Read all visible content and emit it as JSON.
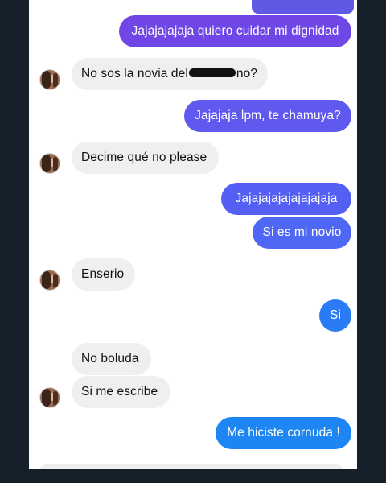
{
  "messages": {
    "m1": "Jajajajajaja quiero cuidar mi dignidad",
    "m2_start": "No sos la novia del",
    "m2_end": "no?",
    "m3": "Jajajaja lpm, te chamuya?",
    "m4": "Decime qué no please",
    "m5": "Jajajajajajajajajaja",
    "m6": "Si es mi novio",
    "m7": "Enserio",
    "m8": "Si",
    "m9": "No boluda",
    "m10": "Si me escribe",
    "m11": "Me hiciste cornuda !"
  },
  "colors": {
    "background": "#16202b",
    "screen": "#ffffff",
    "incoming_bubble": "#efefef",
    "outgoing_purple": "#7046e6",
    "outgoing_violet": "#5f59f0",
    "outgoing_indigo": "#4f67f5",
    "outgoing_blue": "#2a7bf5",
    "outgoing_azure": "#1e86f2"
  },
  "icons": {
    "contact_avatar": "profile-photo-avatar"
  }
}
